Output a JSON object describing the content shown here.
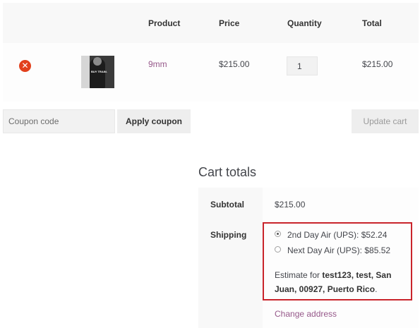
{
  "cart": {
    "headers": {
      "product": "Product",
      "price": "Price",
      "quantity": "Quantity",
      "total": "Total"
    },
    "items": [
      {
        "name": "9mm",
        "image_text": "BUY TRAIN.",
        "price": "$215.00",
        "quantity": "1",
        "total": "$215.00"
      }
    ],
    "coupon": {
      "placeholder": "Coupon code",
      "apply_label": "Apply coupon"
    },
    "update_label": "Update cart"
  },
  "totals": {
    "title": "Cart totals",
    "subtotal_label": "Subtotal",
    "subtotal_value": "$215.00",
    "shipping_label": "Shipping",
    "shipping_options": [
      {
        "label": "2nd Day Air (UPS): $52.24",
        "selected": true
      },
      {
        "label": "Next Day Air (UPS): $85.52",
        "selected": false
      }
    ],
    "estimate_prefix": "Estimate for ",
    "estimate_address": "test123, test, San Juan, 00927, Puerto Rico",
    "estimate_suffix": ".",
    "change_address_label": "Change address"
  },
  "colors": {
    "link": "#96588a",
    "remove": "#e2401c",
    "highlight_border": "#c9242b"
  }
}
